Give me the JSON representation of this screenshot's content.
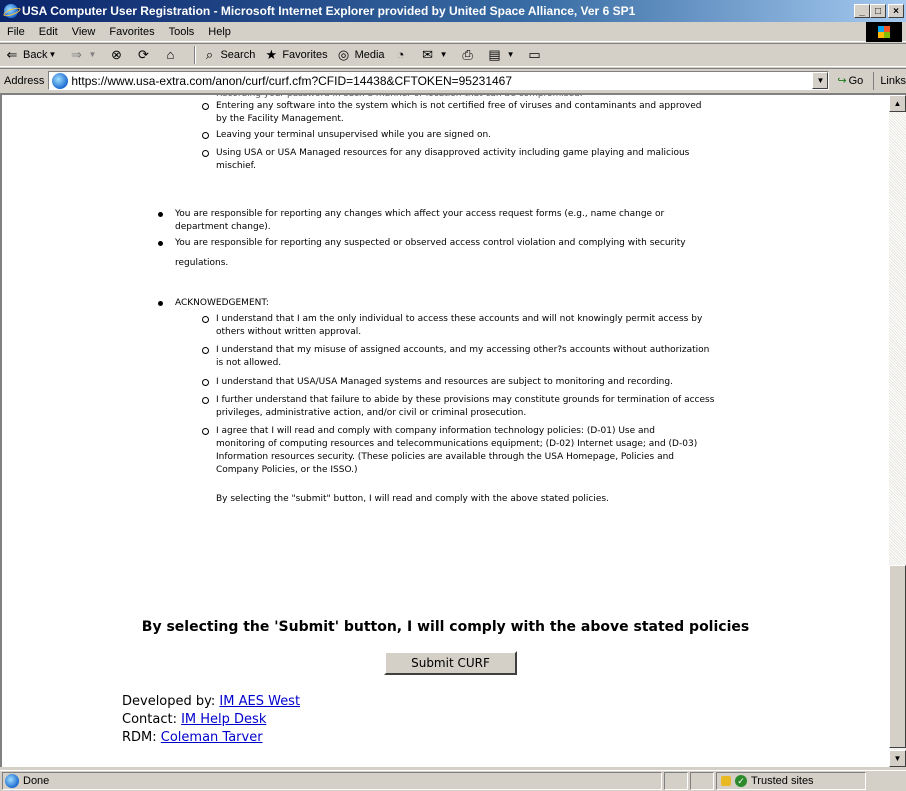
{
  "window": {
    "title": "USA Computer User Registration - Microsoft Internet Explorer provided by United Space Alliance, Ver 6 SP1",
    "buttons": [
      "_",
      "□",
      "×"
    ]
  },
  "menubar": [
    "File",
    "Edit",
    "View",
    "Favorites",
    "Tools",
    "Help"
  ],
  "toolbar": {
    "back": "Back",
    "search": "Search",
    "favorites": "Favorites",
    "media": "Media"
  },
  "addressbar": {
    "label": "Address",
    "url": "https://www.usa-extra.com/anon/curf/curf.cfm?CFID=14438&CFTOKEN=95231467",
    "go": "Go",
    "links": "Links"
  },
  "content": {
    "sub_items_top": [
      [
        "Entering any software into the system which is not certified free of viruses and contaminants and approved",
        "by the Facility Management."
      ],
      [
        "Leaving your terminal unsupervised while you are signed on."
      ],
      [
        "Using USA or USA Managed resources for any disapproved activity including game playing and malicious",
        "mischief."
      ]
    ],
    "bullets": [
      [
        "You are responsible for reporting any changes which affect your access request forms (e.g., name change or",
        "department change)."
      ],
      [
        "You are responsible for reporting any suspected or observed access control violation and complying with security",
        "regulations."
      ]
    ],
    "ack_title": "ACKNOWEDGEMENT:",
    "ack_items": [
      [
        "I understand that I am the only individual to access these accounts and will not knowingly permit access by",
        "others without written approval."
      ],
      [
        "I understand that my misuse of assigned accounts, and my accessing other?s accounts without authorization",
        "is not allowed."
      ],
      [
        "I understand that USA/USA Managed systems and resources are subject to monitoring and recording."
      ],
      [
        "I further understand that failure to abide by these provisions may constitute grounds for termination of access",
        "privileges, administrative action, and/or civil or criminal prosecution."
      ],
      [
        "I agree that I will read and comply with company information technology policies:  (D-01) Use and",
        "monitoring of computing resources and telecommunications equipment;  (D-02) Internet usage; and (D-03)",
        "Information resources security.  (These policies are available through the USA Homepage, Policies and",
        "Company Policies, or the ISSO.)"
      ]
    ],
    "ack_closing": "By selecting the \"submit\" button, I will read and comply with the above stated policies.",
    "heading": "By selecting the 'Submit' button, I will comply with the above stated policies",
    "submit_label": "Submit CURF",
    "credits": {
      "developed_label": "Developed by: ",
      "developed_link": "IM AES West",
      "contact_label": "Contact: ",
      "contact_link": "IM Help Desk",
      "rdm_label": "RDM: ",
      "rdm_link": "Coleman Tarver"
    }
  },
  "statusbar": {
    "status": "Done",
    "zone": "Trusted sites"
  }
}
